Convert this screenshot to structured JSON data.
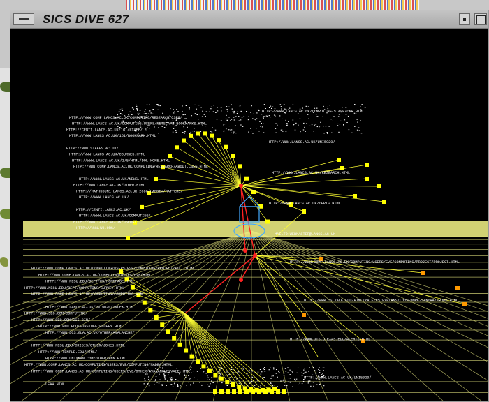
{
  "window": {
    "title": "SICS DIVE 627"
  },
  "colors": {
    "background": "#000000",
    "link_yellow": "#ffff33",
    "node_yellow": "#ffff00",
    "highlight_red": "#ff2222",
    "floor_band": "#e8e880",
    "camera_cyan": "#44aaff"
  },
  "scene": {
    "upper_cluster_labels": [
      "HTTP://WWW.LANCS.AC.UK/COMPUTING/STAFF/CSR.HTML",
      "HTTP://WWW.COMP.LANCS.AC.UK/COMPUTING/RESEARCH/CSEG/",
      "HTTP://WWW.LANCS.AC.UK/COMPUTING/USERS/NETSCAPE-BOOKMARKS.HTML",
      "HTTP://CENTI.LANCS.AC.UK/161/STAFF/",
      "HTTP://WWW.LANCS.AC.UK/161/BOOKMARK.HTML",
      "HTTP://WWW.LANCS.AC.UK/UNI5020/",
      "HTTP://WWW.STAFFS.AC.UK/",
      "HTTP://WWW.LANCS.AC.UK/COURSES.HTML",
      "HTTP://WWW.LANCS.AC.UK/1/5/HTML/DOL-HOME.HTML",
      "HTTP://WWW.COMP.LANCS.AC.UK/COMPUTING/RESEARCH/ABOUT.CSEG.HTML",
      "HTTP://WWW.LANCS.AC.UK/RESEARCH.HTML",
      "HTTP://WWW.LANCS.AC.UK/NEWS.HTML",
      "HTTP://WWW.LANCS.AC.UK/OTHER.HTML",
      "HTTP://MATHSSUN1.LANCS.AC.UK:2080/HARBIV/MATTERS/",
      "HTTP://WWW.LANCS.AC.UK/",
      "HTTP://WWW.LANCS.AC.UK/DEPTS.HTML",
      "HTTP://CENTI.LANCS.AC.UK/",
      "HTTP://WWW.LANCS.AC.UK/COMPUTING/",
      "HTTP://WWW.LANCS.AC.UK/USERS/",
      "HTTP://WWW.W3.ORG/",
      "MAILTO:WEBMASTER@LANCS.AC.UK"
    ],
    "lower_cluster_labels": [
      "HTTP://WWW.COMP.LANCS.AC.UK/COMPUTING/USERS/EVE/COMPUTING/PROJECT/PROJECT.HTML",
      "HTTP://WWW.COMP.LANCS.AC.UK/COMPUTING/USERS/EVE/COMPUTING/PROJECT/FULL.HTML",
      "HTTP://WWW.COMP.LANCS.AC.UK/COMPUTING/USERS/EVE/HTML",
      "HTTP://WWW.NESU.EDU/DEPT/CS/HOMEPAGE.HTML",
      "HTTP://WWW.NESU.EDU/DEPT/COMPUTING/SURVEY.HTML",
      "HTTP://WWW.COMP.LANCS.AC.UK/COMPUTING/COMPUTING.HTML",
      "HTTP://WWW.CS.YALE.EDU/HTML/YALE/CS/HYPLANS/LOOSEMORE-SANDRA/FROOD.HTML",
      "HTTP://WWW.LANCS.AC.UK/UNI5020/INDEX.HTML",
      "HTTP://WWW.SEQ.COM/COMPUTING/",
      "HTTP://WWW.SEQ.COM/CGI-BIN/",
      "HTTP://WWW.EMU.EDU/FUNSTUFF/FLUFFY.HTML",
      "HTTP://WWW.DCS.GLA.AC.UK/OTHER/AVALANCHE/",
      "HTTP://WWW.OTS.UTEXAS.EDU/ALERTS.HTML",
      "HTTP://WWW.NESU.EDU/CRISIS/OTHER/JOKES.HTML",
      "HTTP://WWW.TEMPLE.EDU/HTML/",
      "HTTP://WWW.UNIXMAN.COM/OTHER/ANN.HTML",
      "HTTP://WWW.COMP.LANCS.AC.UK/COMPUTING/USERS/EVE/COMPUTING/NADEA.HTML",
      "HTTP://WWW.COMP.LANCS.AC.UK/COMPUTING/USERS/EVE/OTHER/AVALANCHE/VALE.HTML",
      "HTTP://WWW.LANCS.AC.UK/UNI5020/",
      "LEAH.HTML"
    ]
  }
}
